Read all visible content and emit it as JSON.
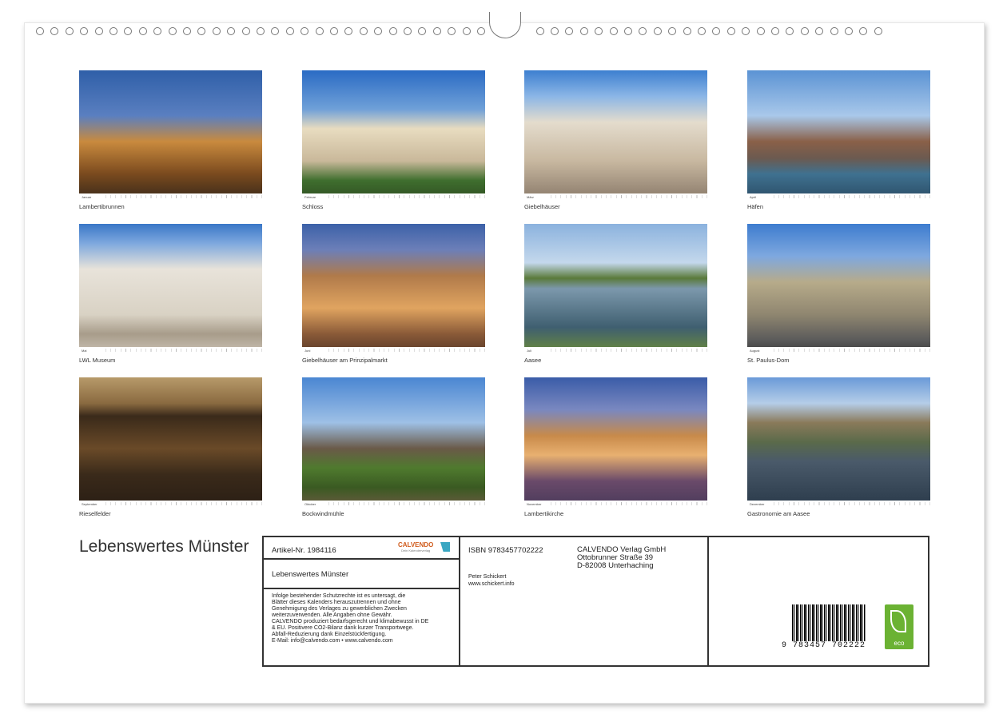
{
  "calendar_title": "Lebenswertes Münster",
  "tiles": [
    {
      "caption": "Lambertibrunnen",
      "month": "Januar",
      "scene": "fountain"
    },
    {
      "caption": "Schloss",
      "month": "Februar",
      "scene": "palace"
    },
    {
      "caption": "Giebelhäuser",
      "month": "März",
      "scene": "gables"
    },
    {
      "caption": "Häfen",
      "month": "April",
      "scene": "harbor"
    },
    {
      "caption": "LWL Museum",
      "month": "Mai",
      "scene": "museum"
    },
    {
      "caption": "Giebelhäuser am Prinzipalmarkt",
      "month": "Juni",
      "scene": "market-night"
    },
    {
      "caption": "Aasee",
      "month": "Juli",
      "scene": "lake"
    },
    {
      "caption": "St. Paulus-Dom",
      "month": "August",
      "scene": "cathedral"
    },
    {
      "caption": "Rieselfelder",
      "month": "September",
      "scene": "nest"
    },
    {
      "caption": "Bockwindmühle",
      "month": "Oktober",
      "scene": "windmill"
    },
    {
      "caption": "Lambertikirche",
      "month": "November",
      "scene": "church-night"
    },
    {
      "caption": "Gastronomie am Aasee",
      "month": "Dezember",
      "scene": "waterfront"
    }
  ],
  "info": {
    "article_label": "Artikel-Nr. 1984116",
    "logo": "CALVENDO",
    "logo_sub": "Dein Kalenderverlag",
    "title": "Lebenswertes Münster",
    "legal": [
      "Infolge bestehender Schutzrechte ist es untersagt, die",
      "Blätter dieses Kalenders herauszutrennen und ohne",
      "Genehmigung des Verlages zu gewerblichen Zwecken",
      "weiterzuverwenden. Alle Angaben ohne Gewähr.",
      "CALVENDO produziert bedarfsgerecht und klimabewusst in DE",
      "& EU. Positivere CO2-Bilanz dank kurzer Transportwege.",
      "Abfall-Reduzierung dank Einzelstückfertigung.",
      "E-Mail: info@calvendo.com • www.calvendo.com"
    ],
    "isbn": "ISBN 9783457702222",
    "author": "Peter Schickert",
    "author_web": "www.schickert.info",
    "publisher": [
      "CALVENDO Verlag GmbH",
      "Ottobrunner Straße 39",
      "D-82008 Unterhaching"
    ],
    "barcode_digits": "9 783457 702222",
    "eco_label": "eco"
  },
  "colors": {
    "border": "#333333",
    "eco_green": "#6bb233",
    "logo_orange": "#d05b1c"
  }
}
